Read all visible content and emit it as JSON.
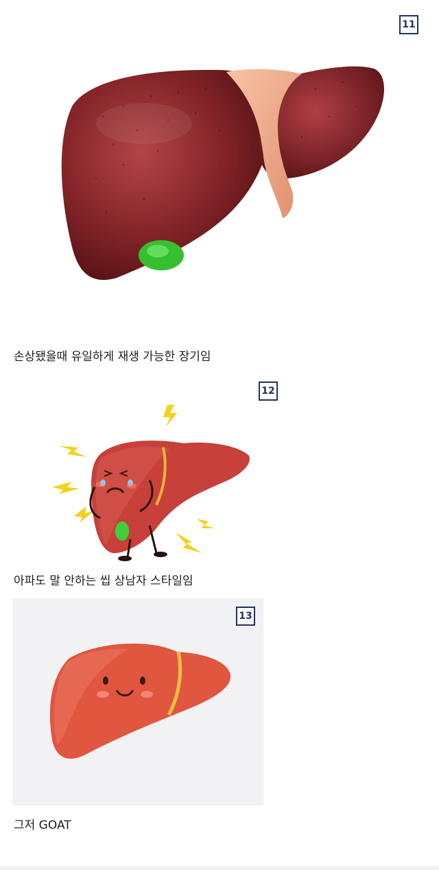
{
  "panels": [
    {
      "badge": "11",
      "caption": "손상됐을때 유일하게 재생 가능한 장기임",
      "icon": "liver-realistic-illustration"
    },
    {
      "badge": "12",
      "caption": "아파도 말 안하는 씹 상남자 스타일임",
      "icon": "liver-in-pain-cartoon"
    },
    {
      "badge": "13",
      "caption": "그저 GOAT",
      "icon": "liver-smiling-cartoon"
    }
  ],
  "colors": {
    "badge_border": "#23305e",
    "liver_dark": "#7a1f22",
    "liver_cartoon": "#e0563f",
    "gallbladder": "#3fcf3a",
    "lightning": "#f2d21b"
  }
}
